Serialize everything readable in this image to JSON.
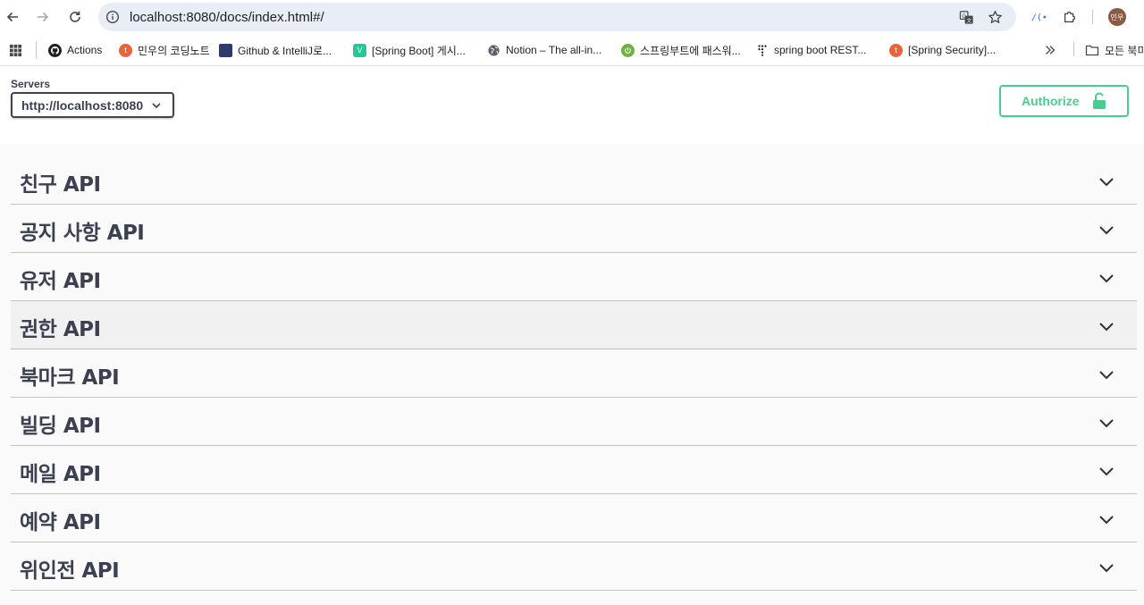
{
  "browser": {
    "url": "localhost:8080/docs/index.html#/",
    "avatar_initials": "민우"
  },
  "bookmarks": [
    {
      "label": "Actions",
      "icon": "github-icon",
      "color": "#1f1f1f"
    },
    {
      "label": "민우의 코딩노트",
      "icon": "blog-icon",
      "color": "#e8643a"
    },
    {
      "label": "Github & IntelliJ로...",
      "icon": "image-favicon",
      "color": "#2d3a6b"
    },
    {
      "label": "[Spring Boot] 게시...",
      "icon": "velog-icon",
      "color": "#20c997"
    },
    {
      "label": "Notion – The all-in...",
      "icon": "globe-icon",
      "color": "#5f6368"
    },
    {
      "label": "스프링부트에 패스워...",
      "icon": "spring-icon",
      "color": "#6db33f"
    },
    {
      "label": "spring boot REST...",
      "icon": "dots-icon",
      "color": "#1f1f1f"
    },
    {
      "label": "[Spring Security]...",
      "icon": "blog-icon",
      "color": "#e8643a"
    }
  ],
  "bookmarks_all_folders": "모든 북미",
  "servers": {
    "label": "Servers",
    "selected": "http://localhost:8080"
  },
  "authorize": {
    "label": "Authorize"
  },
  "tags": [
    {
      "name": "친구 API"
    },
    {
      "name": "공지 사항 API"
    },
    {
      "name": "유저 API"
    },
    {
      "name": "권한 API"
    },
    {
      "name": "북마크 API"
    },
    {
      "name": "빌딩 API"
    },
    {
      "name": "메일 API"
    },
    {
      "name": "예약 API"
    },
    {
      "name": "위인전 API"
    }
  ],
  "colors": {
    "authorize_green": "#49cc90",
    "text": "#3b4151"
  }
}
